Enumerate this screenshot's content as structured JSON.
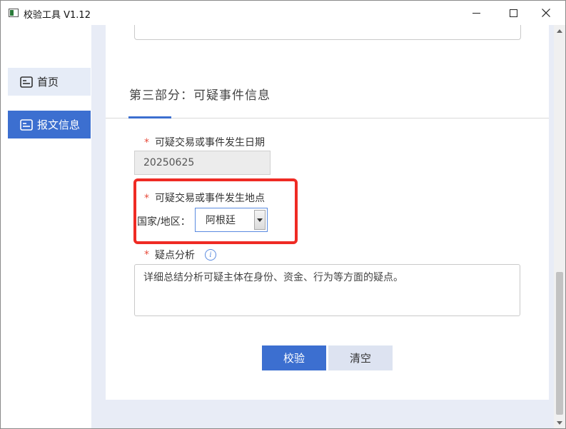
{
  "window": {
    "title": "校验工具 V1.12"
  },
  "sidebar": {
    "items": [
      {
        "label": "首页",
        "active": false
      },
      {
        "label": "报文信息",
        "active": true
      }
    ]
  },
  "section": {
    "title": "第三部分：可疑事件信息"
  },
  "form": {
    "required_mark": "*",
    "date_label": "可疑交易或事件发生日期",
    "date_value": "20250625",
    "place_label": "可疑交易或事件发生地点",
    "country_label": "国家/地区：",
    "country_value": "阿根廷",
    "analysis_label": "疑点分析",
    "analysis_placeholder": "详细总结分析可疑主体在身份、资金、行为等方面的疑点。",
    "info_icon_glyph": "i"
  },
  "actions": {
    "check_label": "校验",
    "clear_label": "清空"
  },
  "colors": {
    "accent": "#3c6fd0",
    "required": "#e74c3c",
    "highlight": "#ef2b24",
    "content_bg": "#e8ecf6"
  },
  "scroll": {
    "thumb_position_fraction": 0.61
  }
}
